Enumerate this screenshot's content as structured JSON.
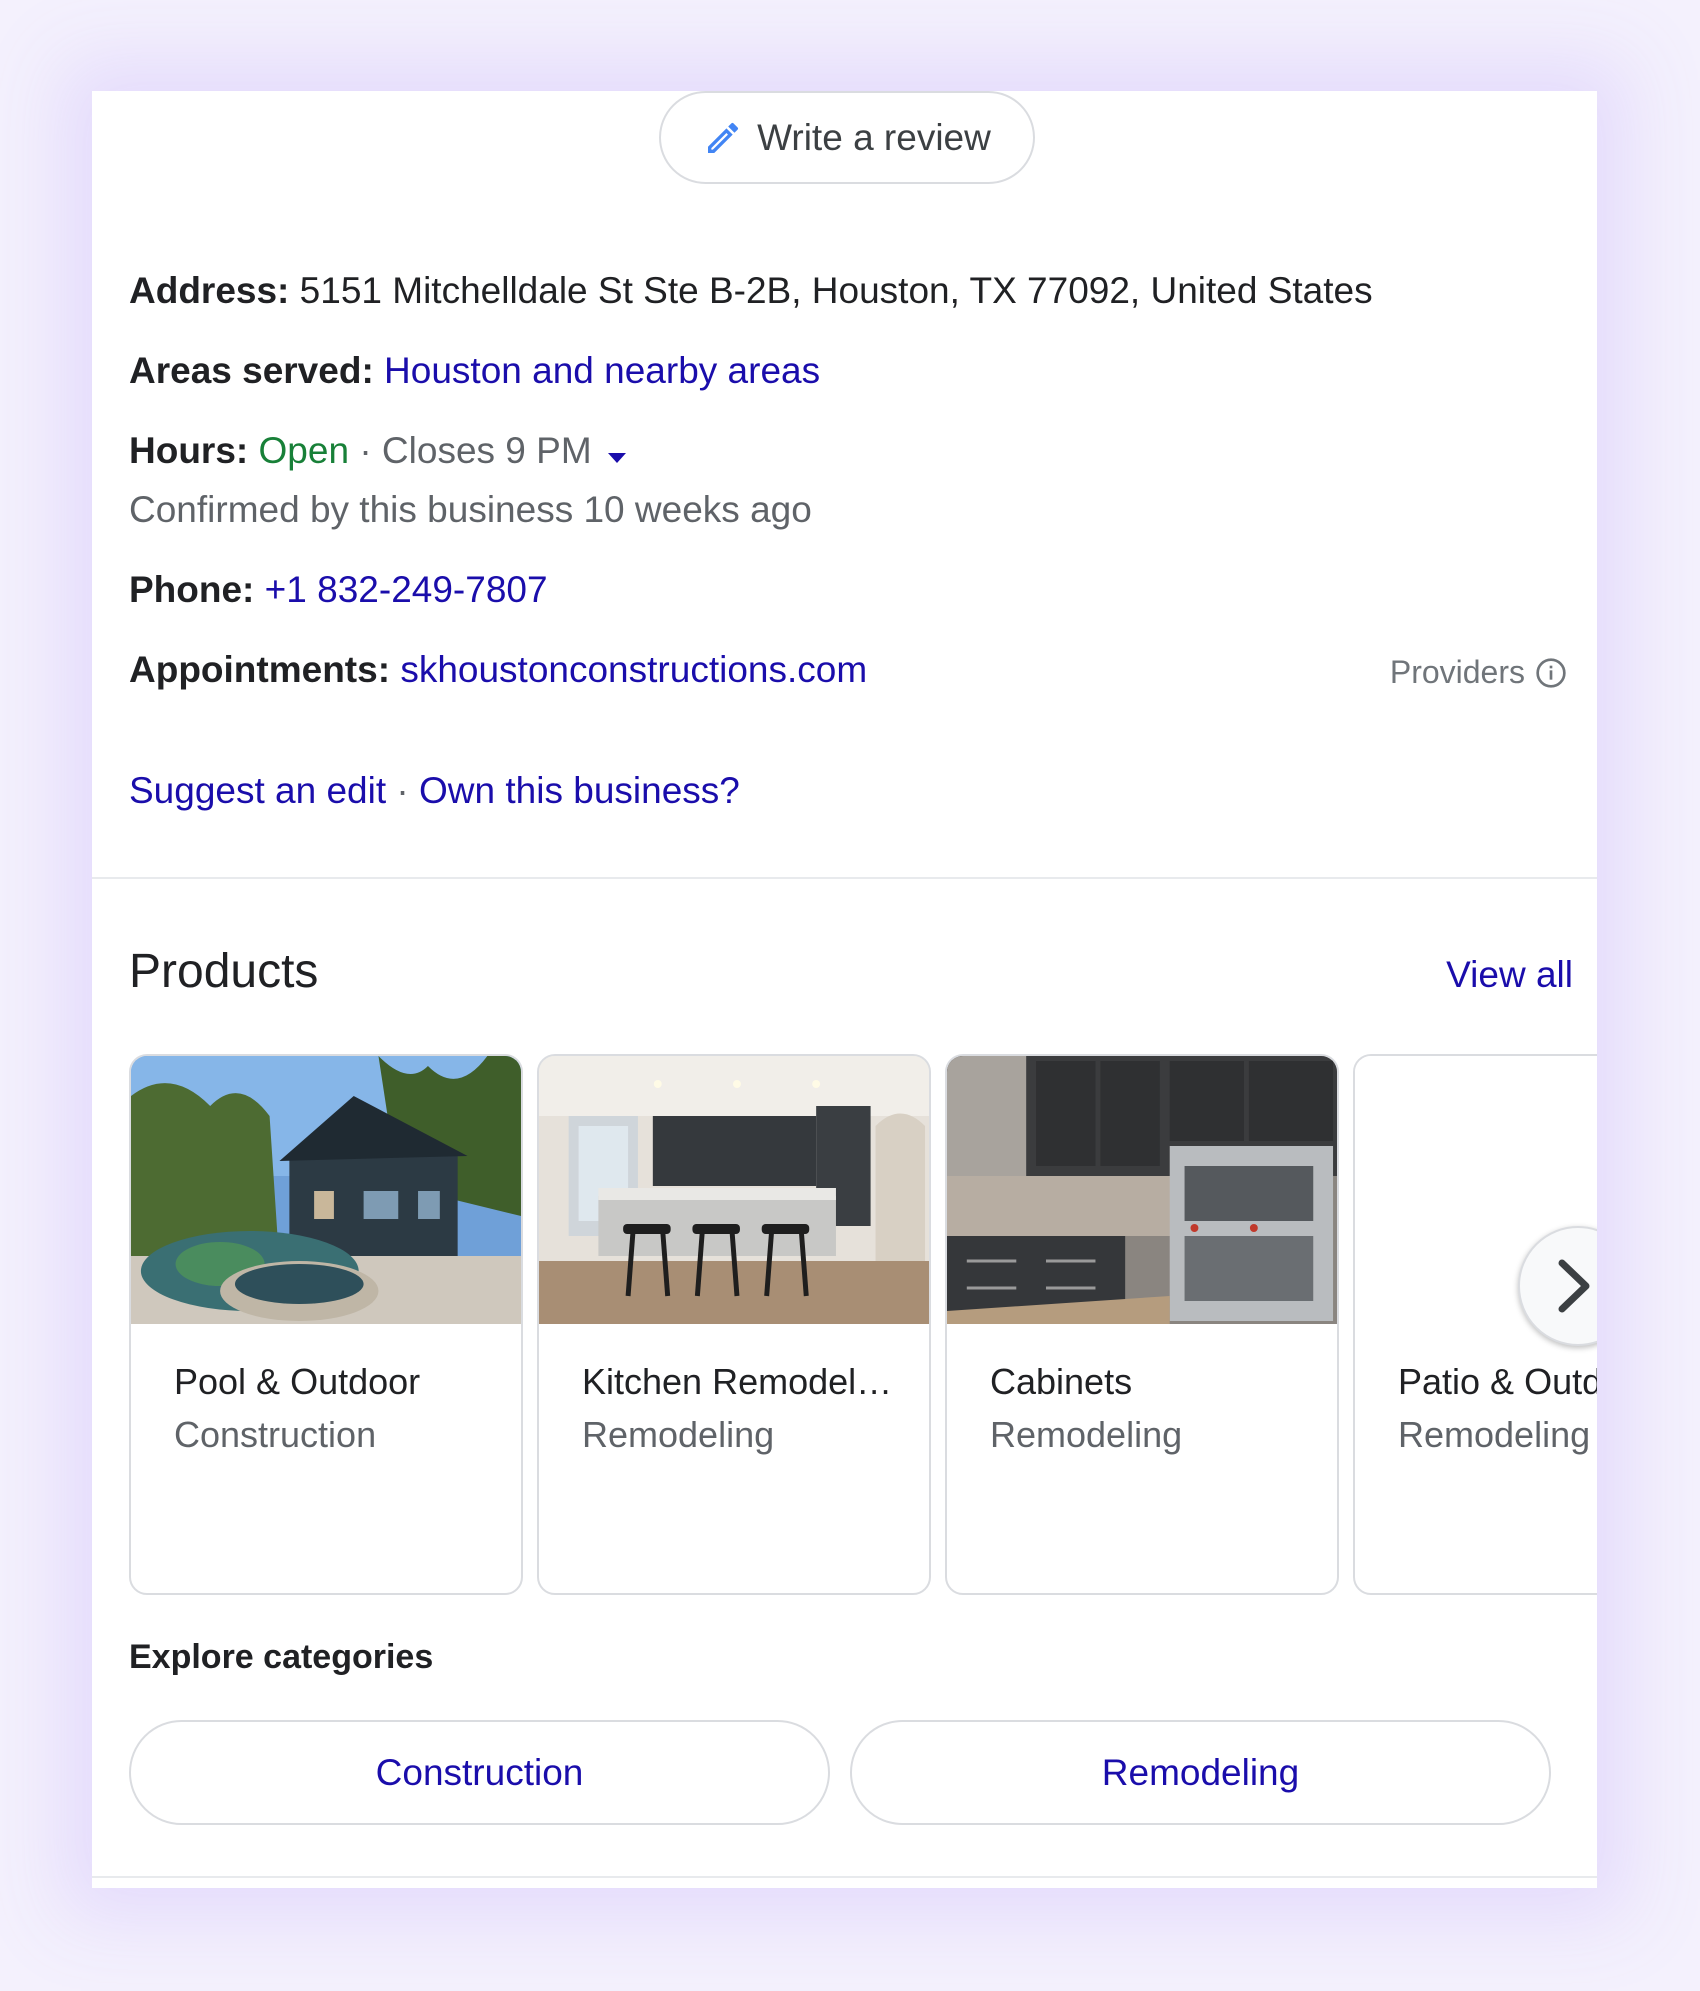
{
  "review_button": {
    "label": "Write a review",
    "icon": "pencil-icon"
  },
  "address": {
    "label": "Address:",
    "value": "5151 Mitchelldale St Ste B-2B, Houston, TX 77092, United States"
  },
  "areas": {
    "label": "Areas served:",
    "value": "Houston and nearby areas"
  },
  "hours": {
    "label": "Hours:",
    "status": "Open",
    "separator": "·",
    "closes": "Closes 9 PM",
    "confirmed": "Confirmed by this business 10 weeks ago"
  },
  "phone": {
    "label": "Phone:",
    "value": "+1 832-249-7807"
  },
  "appointments": {
    "label": "Appointments:",
    "value": "skhoustonconstructions.com",
    "providers": "Providers"
  },
  "edit_links": {
    "suggest": "Suggest an edit",
    "separator": "·",
    "own": "Own this business?"
  },
  "products": {
    "title": "Products",
    "view_all": "View all",
    "items": [
      {
        "name": "Pool & Outdoor",
        "category": "Construction"
      },
      {
        "name": "Kitchen Remodel…",
        "category": "Remodeling"
      },
      {
        "name": "Cabinets",
        "category": "Remodeling"
      },
      {
        "name": "Patio & Outd",
        "category": "Remodeling"
      }
    ]
  },
  "explore": {
    "title": "Explore categories",
    "chips": [
      "Construction",
      "Remodeling"
    ]
  },
  "colors": {
    "link": "#1a0dab",
    "open": "#188038",
    "border": "#dadce0",
    "background_glow": "#e2d8fc"
  }
}
